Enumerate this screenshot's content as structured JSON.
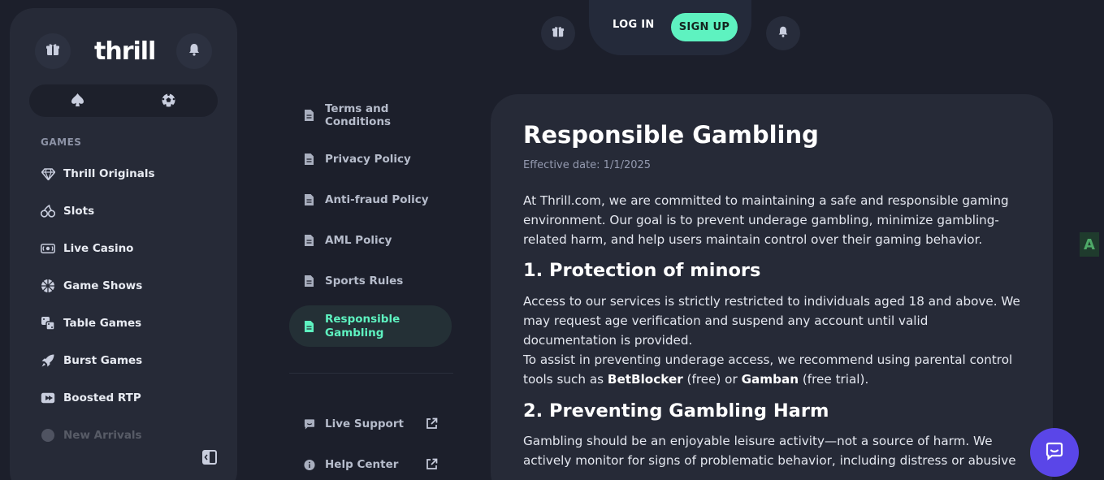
{
  "sidebar": {
    "logo": "thrill",
    "section_label": "GAMES",
    "items": [
      {
        "label": "Thrill Originals",
        "icon": "diamond-icon"
      },
      {
        "label": "Slots",
        "icon": "cherries-icon"
      },
      {
        "label": "Live Casino",
        "icon": "live-icon"
      },
      {
        "label": "Game Shows",
        "icon": "wheel-icon"
      },
      {
        "label": "Table Games",
        "icon": "dice-icon"
      },
      {
        "label": "Burst Games",
        "icon": "rocket-icon"
      },
      {
        "label": "Boosted RTP",
        "icon": "boost-icon"
      },
      {
        "label": "New Arrivals",
        "icon": "star-icon"
      }
    ]
  },
  "header": {
    "login_label": "LOG IN",
    "signup_label": "SIGN UP"
  },
  "policy_menu": {
    "items": [
      {
        "label": "Terms and Conditions"
      },
      {
        "label": "Privacy Policy"
      },
      {
        "label": "Anti-fraud Policy"
      },
      {
        "label": "AML Policy"
      },
      {
        "label": "Sports Rules"
      },
      {
        "label": "Responsible Gambling",
        "active": true
      }
    ],
    "links": [
      {
        "label": "Live Support"
      },
      {
        "label": "Help Center"
      }
    ]
  },
  "content": {
    "title": "Responsible Gambling",
    "effective_date": "Effective date: 1/1/2025",
    "intro": "At Thrill.com, we are committed to maintaining a safe and responsible gaming environment. Our goal is to prevent underage gambling, minimize gambling-related harm, and help users maintain control over their gaming behavior.",
    "section1_title": "1. Protection of minors",
    "section1_p1": "Access to our services is strictly restricted to individuals aged 18 and above. We may request age verification and suspend any account until valid documentation is provided.",
    "section1_p2_before": "To assist in preventing underage access, we recommend using parental control tools such as ",
    "section1_p2_b1": "BetBlocker",
    "section1_p2_mid": " (free) or ",
    "section1_p2_b2": "Gamban",
    "section1_p2_after": " (free trial).",
    "section2_title": "2. Preventing Gambling Harm",
    "section2_p1": "Gambling should be an enjoyable leisure activity—not a source of harm. We actively monitor for signs of problematic behavior, including distress or abusive"
  },
  "translate_badge": "A",
  "colors": {
    "accent": "#5ef2c0",
    "chat": "#5a46e8",
    "background": "#1c1f2b",
    "card": "#262a37"
  }
}
